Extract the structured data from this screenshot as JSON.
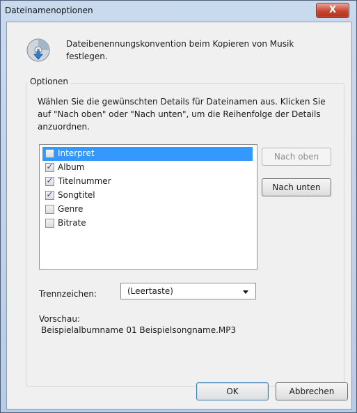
{
  "window": {
    "title": "Dateinamenoptionen",
    "close_glyph": "X"
  },
  "header": {
    "icon": "cd-icon",
    "description": "Dateibenennungskonvention beim Kopieren von Musik festlegen."
  },
  "options": {
    "legend": "Optionen",
    "instructions": "Wählen Sie die gewünschten Details für Dateinamen aus. Klicken Sie auf \"Nach oben\" oder \"Nach unten\", um die Reihenfolge der Details anzuordnen.",
    "items": [
      {
        "label": "Interpret",
        "checked": false,
        "selected": true
      },
      {
        "label": "Album",
        "checked": true,
        "selected": false
      },
      {
        "label": "Titelnummer",
        "checked": true,
        "selected": false
      },
      {
        "label": "Songtitel",
        "checked": true,
        "selected": false
      },
      {
        "label": "Genre",
        "checked": false,
        "selected": false
      },
      {
        "label": "Bitrate",
        "checked": false,
        "selected": false
      }
    ],
    "move_up_label": "Nach oben",
    "move_down_label": "Nach unten",
    "separator_label": "Trennzeichen:",
    "separator_value": "(Leertaste)",
    "preview_label": "Vorschau:",
    "preview_value": "Beispielalbumname 01 Beispielsongname.MP3"
  },
  "footer": {
    "ok_label": "OK",
    "cancel_label": "Abbrechen"
  },
  "colors": {
    "selection": "#3399ff",
    "checkmark": "#2b4a8f",
    "close_button": "#c6452f"
  }
}
